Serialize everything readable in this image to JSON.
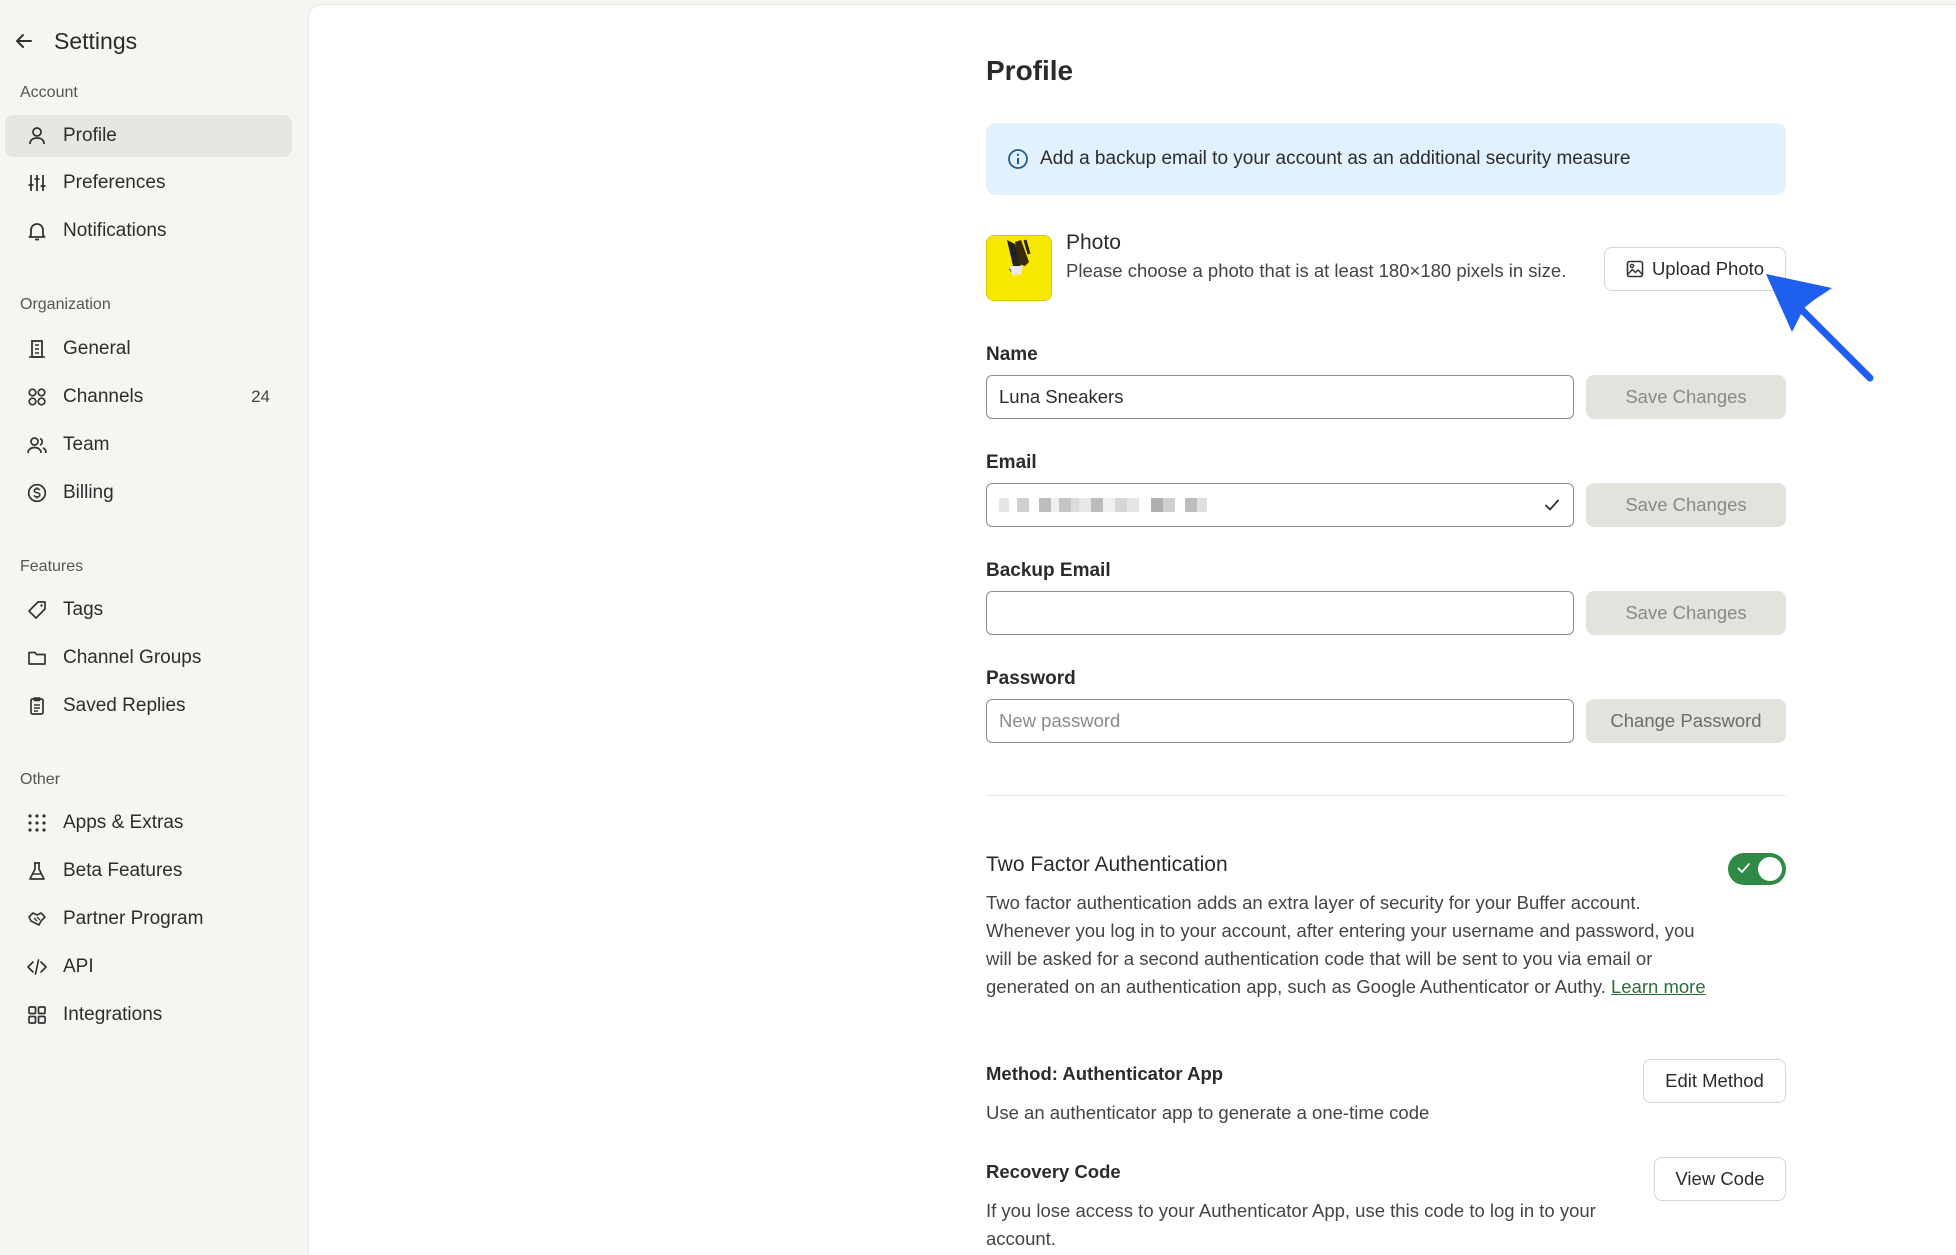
{
  "sidebar": {
    "title": "Settings",
    "sections": [
      {
        "label": "Account",
        "items": [
          {
            "label": "Profile",
            "icon": "user-icon",
            "active": true
          },
          {
            "label": "Preferences",
            "icon": "sliders-icon"
          },
          {
            "label": "Notifications",
            "icon": "bell-icon"
          }
        ]
      },
      {
        "label": "Organization",
        "items": [
          {
            "label": "General",
            "icon": "building-icon"
          },
          {
            "label": "Channels",
            "icon": "grid-circles-icon",
            "count": "24"
          },
          {
            "label": "Team",
            "icon": "users-icon"
          },
          {
            "label": "Billing",
            "icon": "dollar-icon"
          }
        ]
      },
      {
        "label": "Features",
        "items": [
          {
            "label": "Tags",
            "icon": "tag-icon"
          },
          {
            "label": "Channel Groups",
            "icon": "folder-icon"
          },
          {
            "label": "Saved Replies",
            "icon": "clipboard-icon"
          }
        ]
      },
      {
        "label": "Other",
        "items": [
          {
            "label": "Apps & Extras",
            "icon": "dots-grid-icon"
          },
          {
            "label": "Beta Features",
            "icon": "flask-icon"
          },
          {
            "label": "Partner Program",
            "icon": "handshake-icon"
          },
          {
            "label": "API",
            "icon": "code-icon"
          },
          {
            "label": "Integrations",
            "icon": "apps-icon"
          }
        ]
      }
    ]
  },
  "profile": {
    "title": "Profile",
    "banner": "Add a backup email to your account as an additional security measure",
    "photo": {
      "title": "Photo",
      "description": "Please choose a photo that is at least 180×180 pixels in size.",
      "upload_label": "Upload Photo"
    },
    "name": {
      "label": "Name",
      "value": "Luna Sneakers",
      "button": "Save Changes"
    },
    "email": {
      "label": "Email",
      "button": "Save Changes"
    },
    "backup_email": {
      "label": "Backup Email",
      "value": "",
      "button": "Save Changes"
    },
    "password": {
      "label": "Password",
      "placeholder": "New password",
      "button": "Change Password"
    }
  },
  "two_factor": {
    "title": "Two Factor Authentication",
    "enabled": true,
    "description": "Two factor authentication adds an extra layer of security for your Buffer account. Whenever you log in to your account, after entering your username and password, you will be asked for a second authentication code that will be sent to you via email or generated on an authentication app, such as Google Authenticator or Authy.",
    "learn_more": "Learn more",
    "method": {
      "title": "Method: Authenticator App",
      "description": "Use an authenticator app to generate a one-time code",
      "button": "Edit Method"
    },
    "recovery": {
      "title": "Recovery Code",
      "description": "If you lose access to your Authenticator App, use this code to log in to your account.",
      "button": "View Code"
    }
  },
  "colors": {
    "accent_green": "#2f8a45",
    "banner_bg": "#e1f1fd",
    "pointer_arrow": "#1f5ff0"
  }
}
